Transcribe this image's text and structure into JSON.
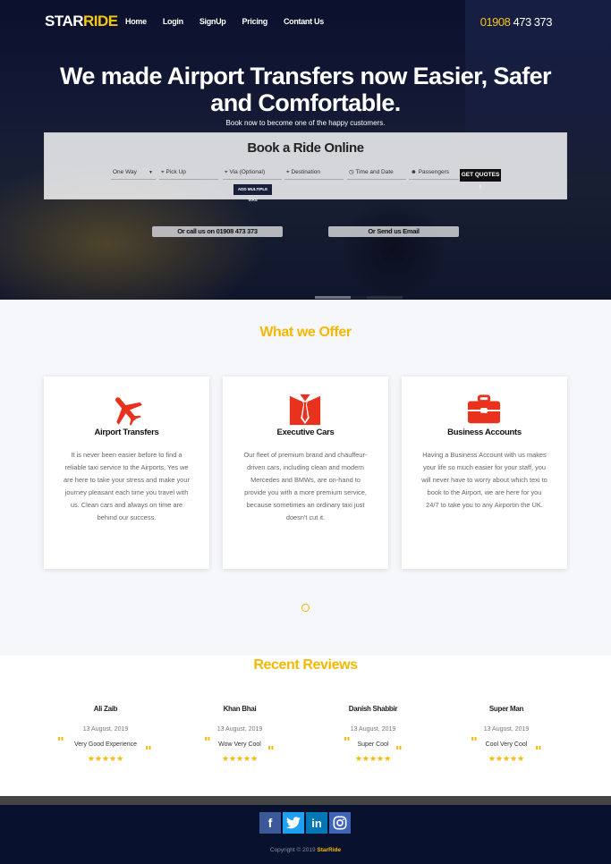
{
  "nav": {
    "logo_a": "STAR",
    "logo_b": "RIDE",
    "links": [
      "Home",
      "Login",
      "SignUp",
      "Pricing",
      "Contant Us"
    ],
    "phone_prefix": "01908",
    "phone_rest": "473 373"
  },
  "hero": {
    "title": "We made Airport Transfers now Easier, Safer and Comfortable.",
    "subtitle": "Book now to become one of the happy customers."
  },
  "booking": {
    "title": "Book a Ride Online",
    "trip_type": "One Way",
    "pickup_placeholder": "Pick Up",
    "via_placeholder": "Via (Optional)",
    "destination_placeholder": "Destination",
    "time_placeholder": "Time and Date",
    "passengers_placeholder": "Passengers",
    "quote_button": "GET QUOTES !",
    "add_via_button": "ADD MULTIPLE VIAS"
  },
  "cta": {
    "call": "Or call us on 01908 473 373",
    "email": "Or Send us Email"
  },
  "offer": {
    "title": "What we Offer",
    "cards": [
      {
        "icon": "airplane-icon",
        "title": "Airport Transfers",
        "text": "It is never been easier before to find a reliable taxi service to the Airports, Yes we are here to take your stress and make your journey pleasant each time you travel with us. Clean cars and always on time are behind our success."
      },
      {
        "icon": "necktie-icon",
        "title": "Executive Cars",
        "text": "Our fleet of premium brand and chauffeur-driven cars, including clean and modern Mercedes and BMWs, are on-hand to provide you with a more premium service, because sometimes an ordinary taxi just doesn't cut it."
      },
      {
        "icon": "briefcase-icon",
        "title": "Business Accounts",
        "text": "Having a Business Account with us makes your life so much easier for your staff, you will never have to worry about which texi to book to the Airport, we are here for you 24/7 to take you to any Airportin the UK."
      }
    ]
  },
  "reviews": {
    "title": "Recent Reviews",
    "items": [
      {
        "name": "Ali Zaib",
        "date": "13 August, 2019",
        "text": "Very Good Experience",
        "rating": 5
      },
      {
        "name": "Khan Bhai",
        "date": "13 August, 2019",
        "text": "Wow Very Cool",
        "rating": 5
      },
      {
        "name": "Danish Shabbir",
        "date": "13 August, 2019",
        "text": "Super Cool",
        "rating": 5
      },
      {
        "name": "Super Man",
        "date": "13 August, 2019",
        "text": "Cool Very Cool",
        "rating": 5
      }
    ]
  },
  "footer": {
    "social": [
      "facebook-icon",
      "twitter-icon",
      "linkedin-icon",
      "instagram-icon"
    ],
    "copyright": "Copyright © 2019",
    "brand": "StarRide"
  },
  "colors": {
    "accent": "#f5b800",
    "navy": "#08122e",
    "red": "#e8321e"
  }
}
